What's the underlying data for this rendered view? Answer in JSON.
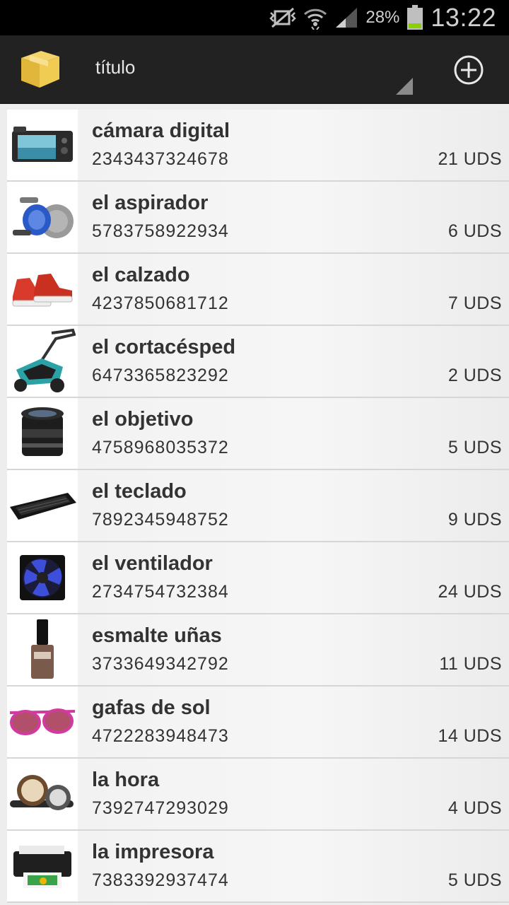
{
  "status_bar": {
    "battery_percent": "28%",
    "time": "13:22",
    "icons": [
      "nfc-icon",
      "wifi-icon",
      "signal-icon",
      "battery-icon"
    ]
  },
  "action_bar": {
    "title": "título",
    "app_icon": "box-icon",
    "add_icon": "add-circle-icon"
  },
  "items": [
    {
      "name": "cámara digital",
      "code": "2343437324678",
      "qty": "21 UDS",
      "icon": "camera-icon"
    },
    {
      "name": "el aspirador",
      "code": "5783758922934",
      "qty": "6 UDS",
      "icon": "vacuum-icon"
    },
    {
      "name": "el calzado",
      "code": "4237850681712",
      "qty": "7 UDS",
      "icon": "shoes-icon"
    },
    {
      "name": "el cortacésped",
      "code": "6473365823292",
      "qty": "2 UDS",
      "icon": "lawnmower-icon"
    },
    {
      "name": "el objetivo",
      "code": "4758968035372",
      "qty": "5 UDS",
      "icon": "lens-icon"
    },
    {
      "name": "el teclado",
      "code": "7892345948752",
      "qty": "9 UDS",
      "icon": "keyboard-icon"
    },
    {
      "name": "el ventilador",
      "code": "2734754732384",
      "qty": "24 UDS",
      "icon": "fan-icon"
    },
    {
      "name": "esmalte uñas",
      "code": "3733649342792",
      "qty": "11 UDS",
      "icon": "nail-polish-icon"
    },
    {
      "name": "gafas de sol",
      "code": "4722283948473",
      "qty": "14 UDS",
      "icon": "sunglasses-icon"
    },
    {
      "name": "la hora",
      "code": "7392747293029",
      "qty": "4 UDS",
      "icon": "watch-icon"
    },
    {
      "name": "la impresora",
      "code": "7383392937474",
      "qty": "5 UDS",
      "icon": "printer-icon"
    }
  ]
}
